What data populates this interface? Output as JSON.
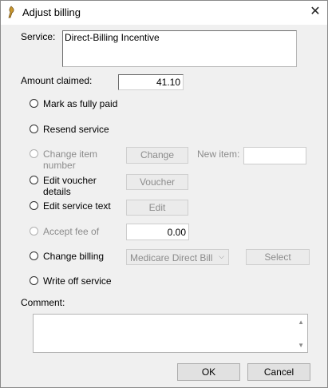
{
  "window": {
    "title": "Adjust billing",
    "close_glyph": "✕"
  },
  "service": {
    "label": "Service:",
    "value": "Direct-Billing Incentive"
  },
  "amount": {
    "label": "Amount claimed:",
    "value": "41.10"
  },
  "options": {
    "mark_paid": "Mark as fully paid",
    "resend": "Resend service",
    "change_item": "Change item number",
    "change_item_button": "Change",
    "new_item_label": "New item:",
    "new_item_value": "",
    "edit_voucher": "Edit voucher details",
    "voucher_button": "Voucher",
    "edit_text": "Edit service text",
    "edit_button": "Edit",
    "accept_fee": "Accept fee of",
    "accept_fee_value": "0.00",
    "change_billing": "Change billing",
    "billing_selected": "Medicare Direct Bill",
    "select_button": "Select",
    "write_off": "Write off service"
  },
  "comment": {
    "label": "Comment:",
    "value": ""
  },
  "footer": {
    "ok": "OK",
    "cancel": "Cancel"
  },
  "icons": {
    "app": "app-logo-icon",
    "close": "close-icon",
    "dropdown": "chevron-down-icon",
    "scroll_up": "scroll-up-icon",
    "scroll_down": "scroll-down-icon"
  }
}
